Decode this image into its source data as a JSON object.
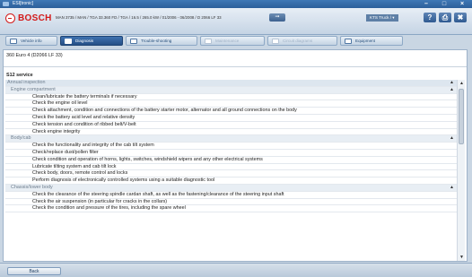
{
  "window": {
    "title": "ESI[tronic]"
  },
  "header": {
    "logo_text": "BOSCH",
    "vehicle_description": "MAN 3735 / MAN / TGA 33.360 FD / TGA / 16.5 / 265.0 kW / 01/2006 - 06/2008 / D 2066 LF 33",
    "kts_label": "KTS Truck / ▾",
    "help_label": "?",
    "print_label": "⎙",
    "exit_label": "✖"
  },
  "tabs": [
    {
      "label": "Vehicle info",
      "state": "normal"
    },
    {
      "label": "Diagnosis",
      "state": "active"
    },
    {
      "label": "Trouble-shooting",
      "state": "normal"
    },
    {
      "label": "Maintenance",
      "state": "disabled"
    },
    {
      "label": "Circuit diagrams",
      "state": "disabled"
    },
    {
      "label": "Equipment",
      "state": "normal"
    }
  ],
  "main": {
    "vehicle_title": "360 Euro 4 (D2066 LF 33)",
    "service_title": "S12 service",
    "rows": [
      {
        "type": "section",
        "text": "Annual inspection"
      },
      {
        "type": "group",
        "text": "Engine compartment"
      },
      {
        "type": "item",
        "text": "Clean/lubricate the battery terminals if necessary"
      },
      {
        "type": "item",
        "text": "Check the engine oil level"
      },
      {
        "type": "item",
        "text": "Check attachment, condition and connections of the battery starter motor, alternator and all ground connections on the body"
      },
      {
        "type": "item",
        "text": "Check the battery acid level and relative density"
      },
      {
        "type": "item",
        "text": "Check tension and condition of ribbed belt/V-belt"
      },
      {
        "type": "item",
        "text": "Check engine integrity"
      },
      {
        "type": "group",
        "text": "Body/cab"
      },
      {
        "type": "item",
        "text": "Check the functionality and integrity of the cab tilt system"
      },
      {
        "type": "item",
        "text": "Check/replace dust/pollen filter"
      },
      {
        "type": "item",
        "text": "Check condition and operation of horns, lights, switches, windshield wipers and any other electrical systems"
      },
      {
        "type": "item",
        "text": "Lubricate tilting system and cab tilt lock"
      },
      {
        "type": "item",
        "text": "Check body, doors, remote control and locks"
      },
      {
        "type": "item",
        "text": "Perform diagnosis of electronically controlled systems using a suitable diagnostic tool"
      },
      {
        "type": "group",
        "text": "Chassis/lower body"
      },
      {
        "type": "item",
        "text": "Check the clearance of the steering spindle cardan shaft, as well as the fastening/clearance of the steering input shaft"
      },
      {
        "type": "item",
        "text": "Check the air suspension (in particular for cracks in the collars)"
      },
      {
        "type": "item",
        "text": "Check the condition and pressure of the tires, including the spare wheel"
      }
    ]
  },
  "footer": {
    "back_label": "Back"
  }
}
